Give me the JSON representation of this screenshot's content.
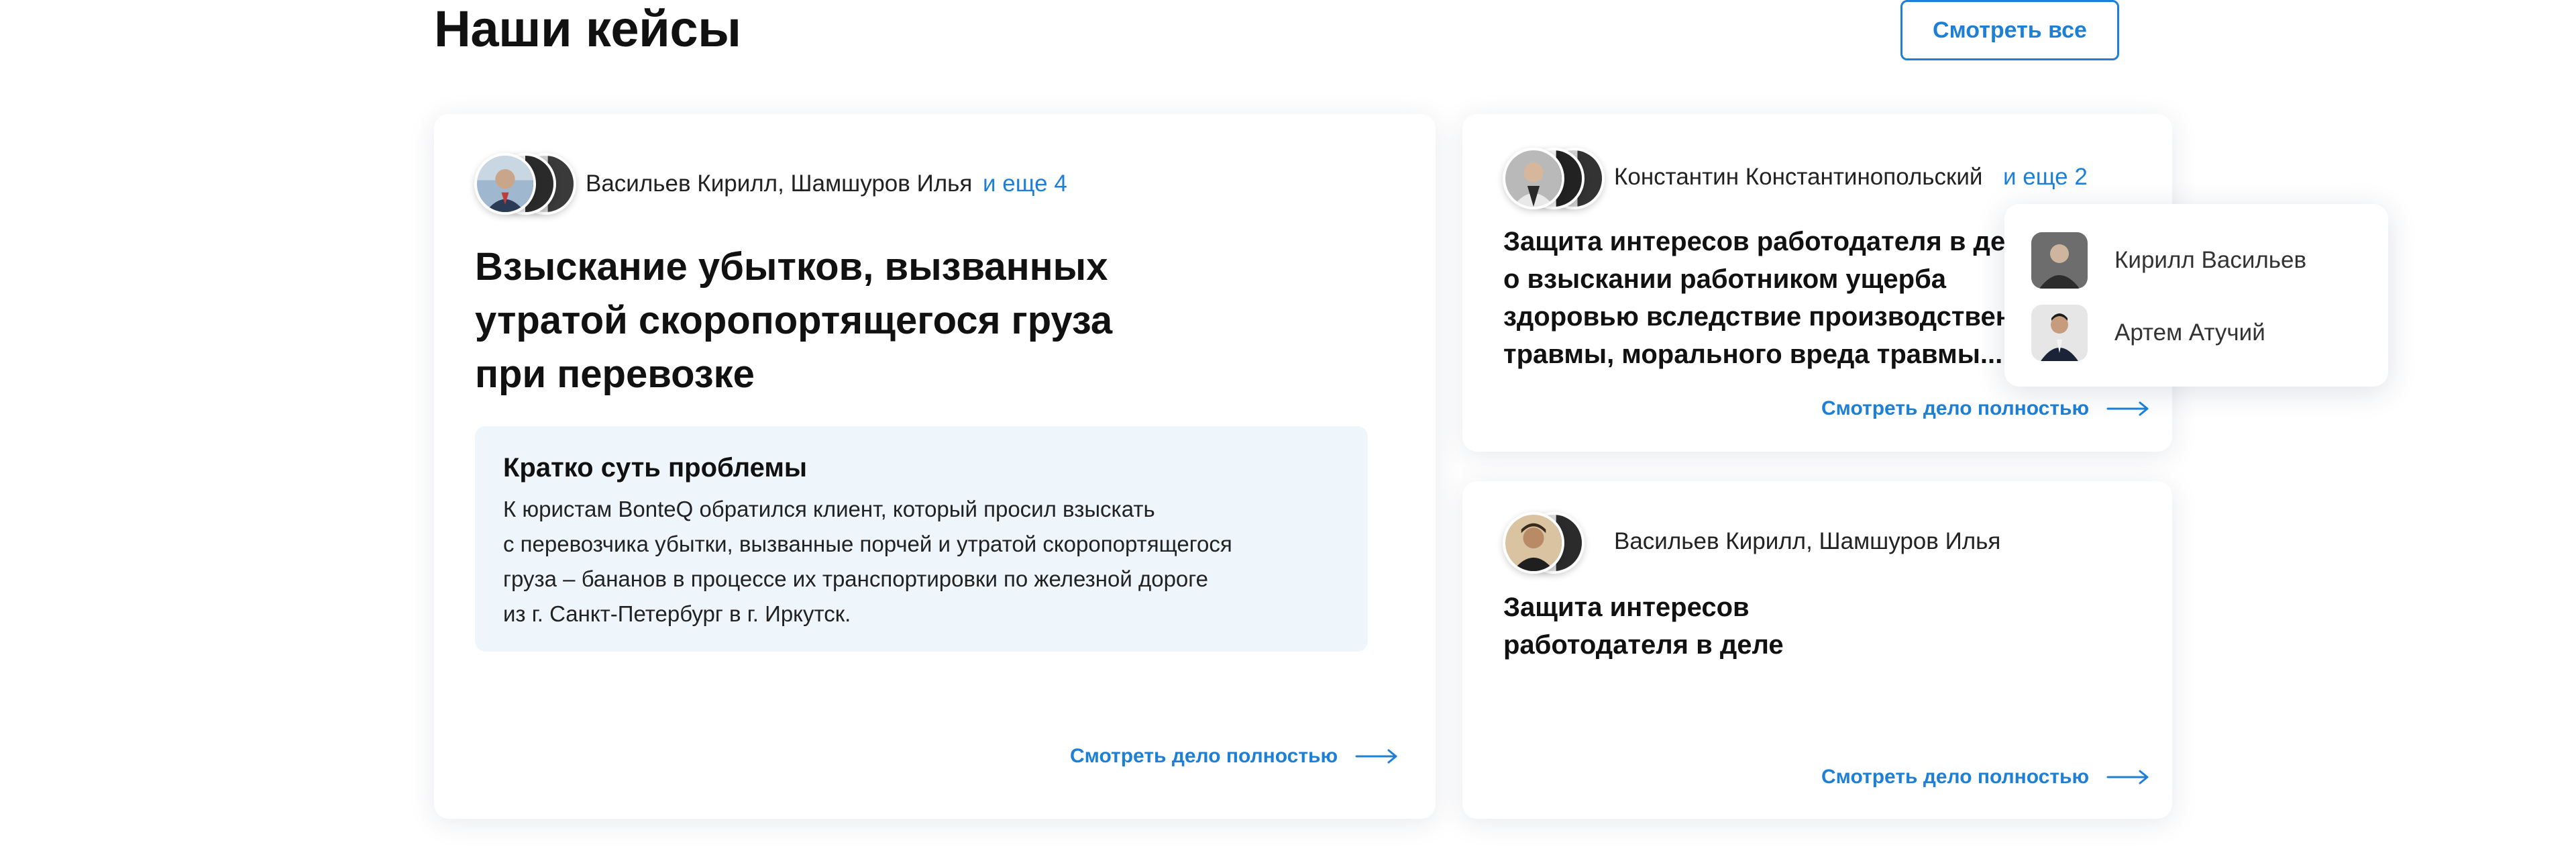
{
  "page": {
    "title": "Наши кейсы",
    "view_all_label": "Смотреть все"
  },
  "cases": [
    {
      "authors": "Васильев Кирилл, Шамшуров Илья",
      "more": "и еще 4",
      "heading_lines": [
        "Взыскание убытков, вызванных",
        "утратой скоропортящегося груза",
        "при перевозке"
      ],
      "summary_title": "Кратко суть проблемы",
      "summary_text": "К юристам BonteQ обратился клиент, который просил взыскать\nс перевозчика убытки, вызванные порчей и утратой скоропортящегося\nгруза – бананов  в процессе их транспортировки по железной дороге\nиз г. Санкт-Петербург в г. Иркутск.",
      "link": "Смотреть дело полностью"
    },
    {
      "authors": "Константин Константинопольский",
      "more": "и еще 2",
      "heading_lines": [
        "Защита интересов работодателя в деле",
        "о взыскании работником ущерба",
        "здоровью вследствие производственной",
        "травмы, морального вреда травмы..."
      ],
      "link": "Смотреть дело полностью"
    },
    {
      "authors": "Васильев Кирилл, Шамшуров Илья",
      "heading_lines": [
        "Защита интересов",
        "работодателя в деле"
      ],
      "link": "Смотреть дело полностью"
    }
  ],
  "popup": {
    "people": [
      "Кирилл Васильев",
      "Артем Атучий"
    ]
  },
  "colors": {
    "accent": "#1e7fd6",
    "summary_bg": "#eef5fb",
    "text": "#111111"
  },
  "icons": [
    "avatar",
    "arrow-right-icon"
  ]
}
